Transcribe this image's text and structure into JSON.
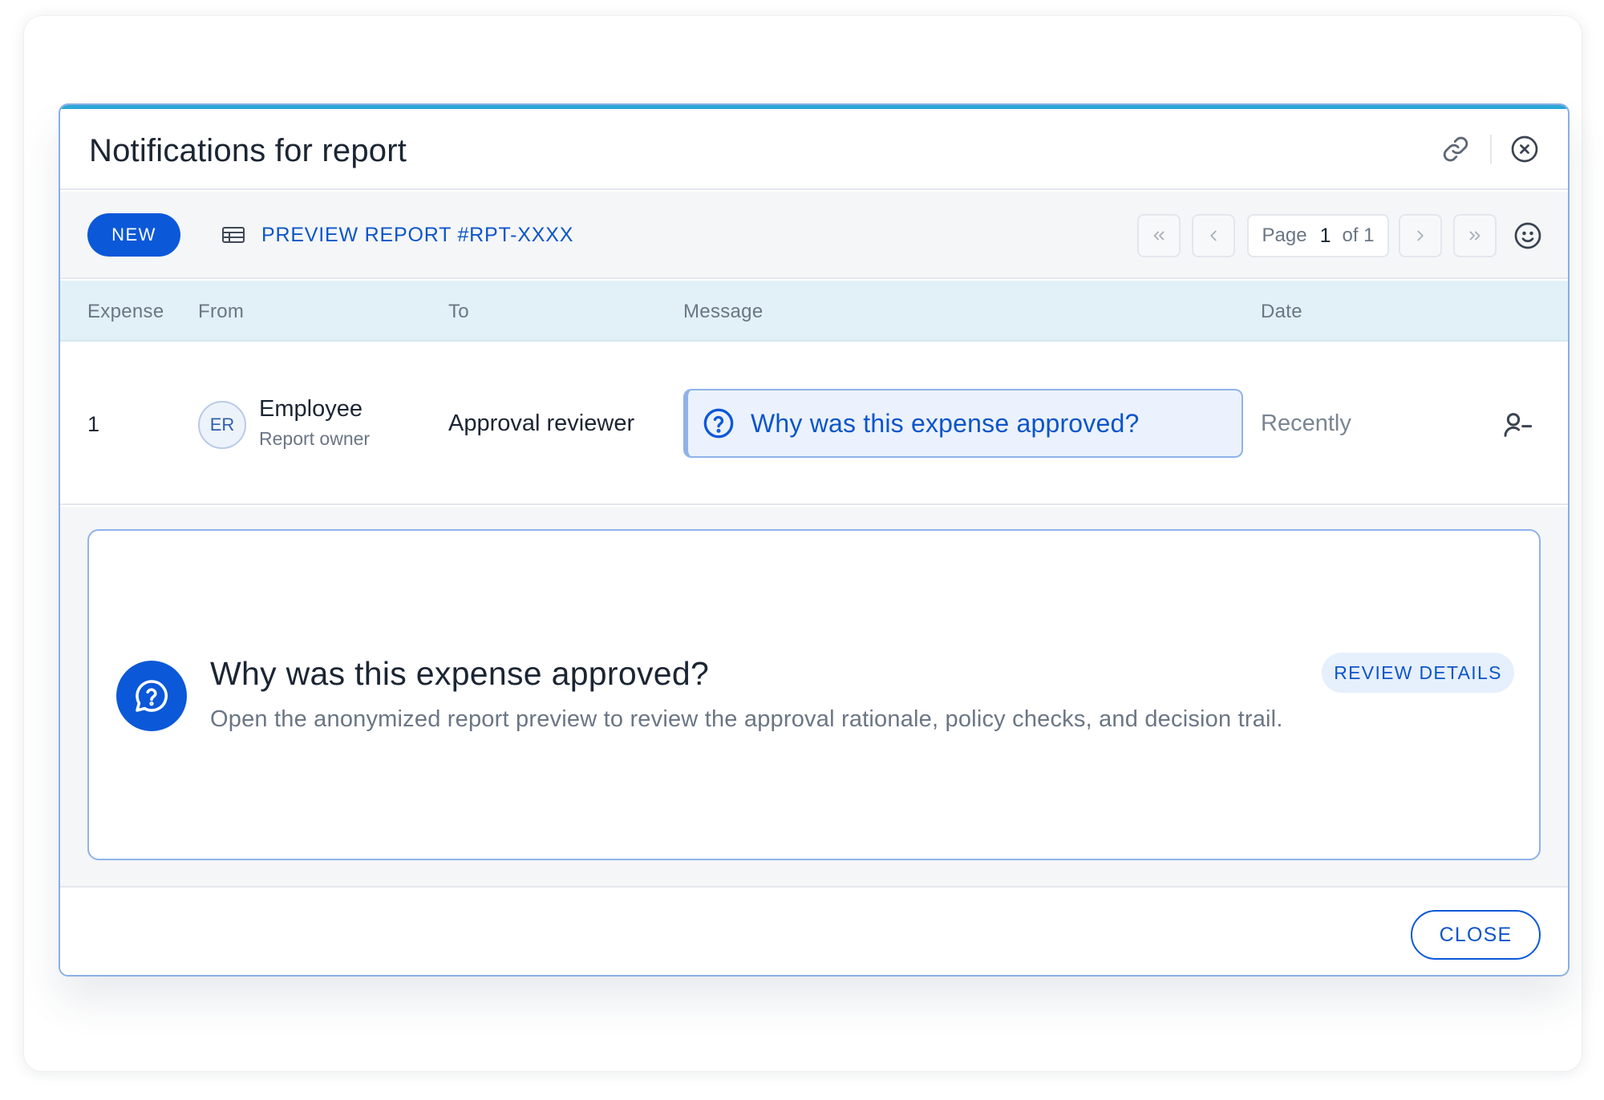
{
  "dialog": {
    "title": "Notifications for report",
    "icons": {
      "link": "link-icon",
      "close": "close-circle-icon"
    }
  },
  "toolbar": {
    "new_label": "NEW",
    "preview_icon": "table-icon",
    "preview_label": "PREVIEW REPORT #RPT-XXXX",
    "pagination": {
      "page_word": "Page",
      "current": "1",
      "of_label": "of 1",
      "icons": [
        "chevrons-left-icon",
        "chevron-left-icon",
        "chevron-right-icon",
        "chevrons-right-icon"
      ]
    },
    "smile_icon": "smile-icon"
  },
  "table": {
    "headers": [
      "Expense",
      "From",
      "To",
      "Message",
      "Date"
    ],
    "rows": [
      {
        "expense": "1",
        "avatar_initials": "ER",
        "from_name": "Employee",
        "from_role": "Report owner",
        "to": "Approval reviewer",
        "message": "Why was this expense approved?",
        "message_icon": "help-circle-icon",
        "date": "Recently",
        "action_icon": "user-minus-icon"
      }
    ]
  },
  "detail": {
    "icon": "message-question-icon",
    "title": "Why was this expense approved?",
    "description": "Open the anonymized report preview to review the approval rationale, policy checks, and decision trail.",
    "action_label": "REVIEW DETAILS"
  },
  "footer": {
    "close_label": "CLOSE"
  },
  "colors": {
    "accent": "#0b58d9",
    "accent_text": "#0c55c9",
    "top_bar": "#2aa7d6",
    "header_row_bg": "#e1f1f7",
    "message_bg": "#ebf2fd"
  }
}
